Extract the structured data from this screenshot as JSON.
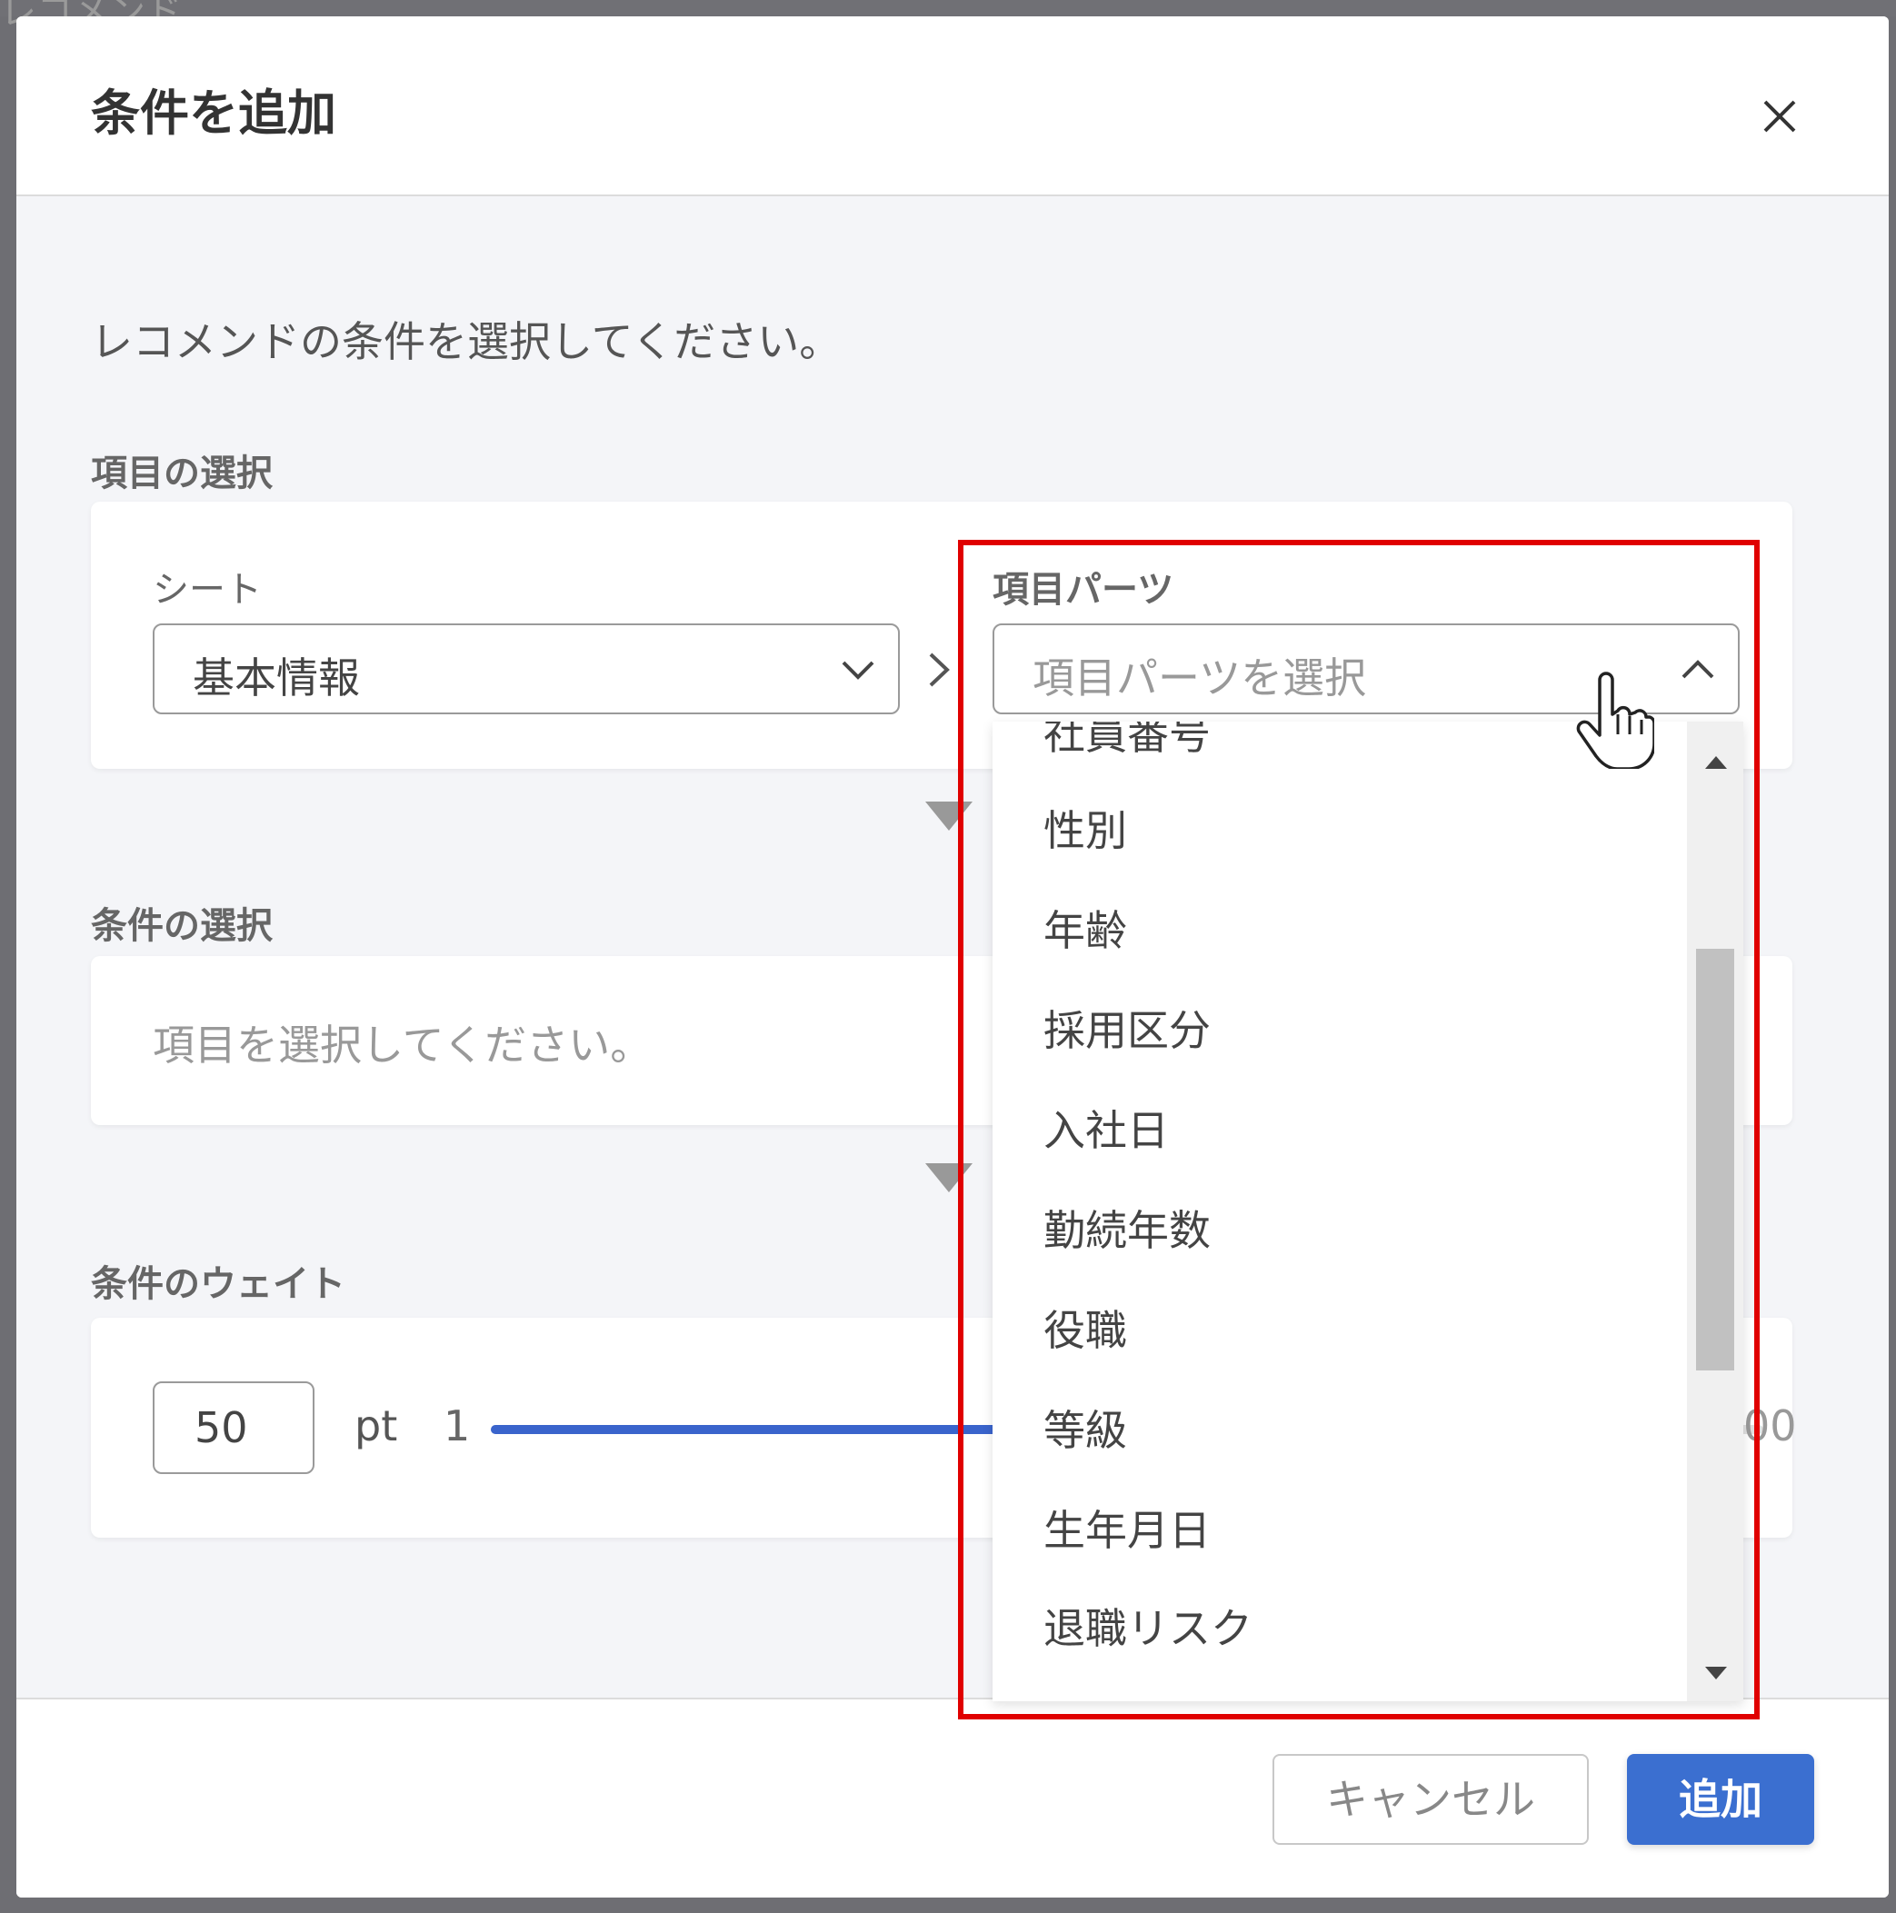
{
  "backdrop": {
    "fragment": "レコメンド"
  },
  "dialog": {
    "title": "条件を追加",
    "close_icon": "close-icon",
    "instruction": "レコメンドの条件を選択してください。"
  },
  "item_selection": {
    "section_label": "項目の選択",
    "sheet": {
      "label": "シート",
      "value": "基本情報"
    },
    "item_parts": {
      "label": "項目パーツ",
      "placeholder": "項目パーツを選択",
      "options": [
        "社員番号",
        "性別",
        "年齢",
        "採用区分",
        "入社日",
        "勤続年数",
        "役職",
        "等級",
        "生年月日",
        "退職リスク"
      ]
    }
  },
  "condition_selection": {
    "section_label": "条件の選択",
    "empty_message": "項目を選択してください。"
  },
  "condition_weight": {
    "section_label": "条件のウェイト",
    "value": "50",
    "unit": "pt",
    "min": "1",
    "max_visible": "00",
    "fill_fraction": 0.5
  },
  "footer": {
    "cancel_label": "キャンセル",
    "add_label": "追加"
  },
  "colors": {
    "accent": "#3b6fd0",
    "slider": "#3a64cc",
    "highlight": "#e00000"
  }
}
